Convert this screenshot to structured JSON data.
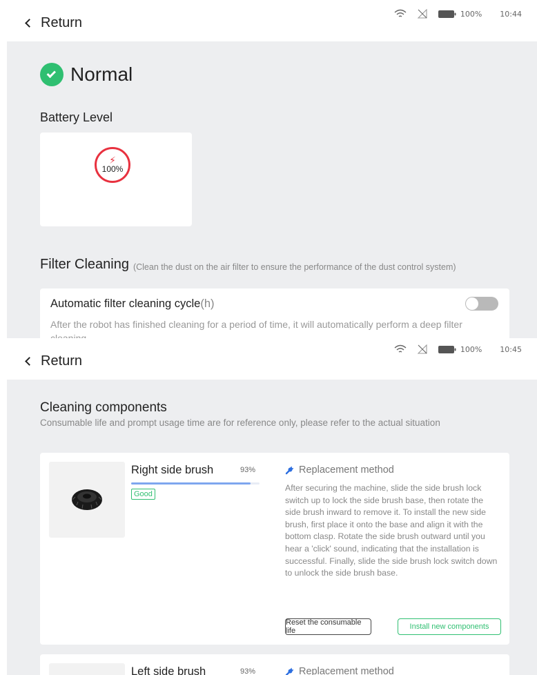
{
  "screen1": {
    "back_label": "Return",
    "status": {
      "battery": "100%",
      "time": "10:44"
    },
    "status_title": "Normal",
    "battery": {
      "title": "Battery Level",
      "value": "100%"
    },
    "filter": {
      "title": "Filter Cleaning",
      "note": "(Clean the dust on the air filter to ensure the performance of the dust control system)",
      "auto": {
        "title": "Automatic filter cleaning cycle",
        "unit": "(h)",
        "description": "After the robot has finished cleaning for a period of time, it will automatically perform a deep filter cleaning",
        "enabled": false
      }
    }
  },
  "screen2": {
    "back_label": "Return",
    "status": {
      "battery": "100%",
      "time": "10:45"
    },
    "title": "Cleaning components",
    "subtitle": "Consumable life and prompt usage time are for reference only, please refer to the actual situation",
    "components": [
      {
        "name": "Right side brush",
        "percent_label": "93%",
        "life_fraction": 0.93,
        "status": "Good",
        "method_title": "Replacement method",
        "method_text": "After securing the machine, slide the side brush lock switch up to lock the side brush base, then rotate the side brush inward to remove it. To install the new side brush, first place it onto the base and align it with the bottom clasp. Rotate the side brush outward until you hear a 'click' sound, indicating that the installation is successful. Finally, slide the side brush lock switch down to unlock the side brush base.",
        "reset_label": "Reset the consumable life",
        "install_label": "Install new components"
      },
      {
        "name": "Left side brush",
        "percent_label": "93%",
        "method_title": "Replacement method"
      }
    ]
  },
  "colors": {
    "accent_green": "#2fbf71",
    "battery_red": "#e8313f",
    "progress_blue": "#7ea6ef",
    "wrench_blue": "#2d6fe0",
    "background_gray": "#edeef0"
  },
  "icons": [
    "back-chevron-icon",
    "wifi-icon",
    "no-signal-icon",
    "battery-icon",
    "check-circle-icon",
    "lightning-bolt-icon",
    "side-brush-image",
    "wrench-icon"
  ]
}
